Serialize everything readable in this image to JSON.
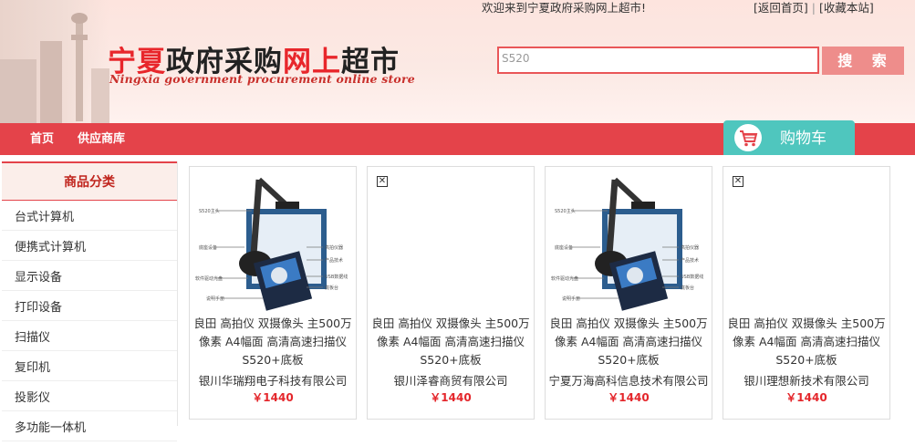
{
  "header": {
    "welcome": "欢迎来到宁夏政府采购网上超市!",
    "back_home": "[返回首页]",
    "bookmark": "[收藏本站]",
    "sep": "|",
    "title_part1": "宁夏",
    "title_part2": "政府采购",
    "title_part3": "网上",
    "title_part4": "超市",
    "subtitle": "Ningxia government procurement online store"
  },
  "search": {
    "value": "S520",
    "button_label": "搜 索"
  },
  "nav": {
    "items": [
      "首页",
      "供应商库"
    ]
  },
  "cart": {
    "label": "购物车"
  },
  "sidebar": {
    "title": "商品分类",
    "items": [
      "台式计算机",
      "便携式计算机",
      "显示设备",
      "打印设备",
      "扫描仪",
      "复印机",
      "投影仪",
      "多功能一体机"
    ]
  },
  "products": [
    {
      "name1": "良田 高拍仪 双摄像头 主500万",
      "name2": "像素 A4幅面 高清高速扫描仪",
      "name3": "S520+底板",
      "seller": "银川华瑞翔电子科技有限公司",
      "price": "￥1440",
      "image": "scanner-photo"
    },
    {
      "name1": "良田 高拍仪 双摄像头 主500万",
      "name2": "像素 A4幅面 高清高速扫描仪",
      "name3": "S520+底板",
      "seller": "银川泽睿商贸有限公司",
      "price": "￥1440",
      "image": "broken-image"
    },
    {
      "name1": "良田 高拍仪 双摄像头 主500万",
      "name2": "像素 A4幅面 高清高速扫描仪",
      "name3": "S520+底板",
      "seller": "宁夏万海高科信息技术有限公司",
      "price": "￥1440",
      "image": "scanner-photo"
    },
    {
      "name1": "良田 高拍仪 双摄像头 主500万",
      "name2": "像素 A4幅面 高清高速扫描仪",
      "name3": "S520+底板",
      "seller": "银川理想新技术有限公司",
      "price": "￥1440",
      "image": "broken-image"
    }
  ],
  "colors": {
    "brand_red": "#e4434a",
    "cart_teal": "#4fc6be",
    "price_red": "#e4262b"
  }
}
